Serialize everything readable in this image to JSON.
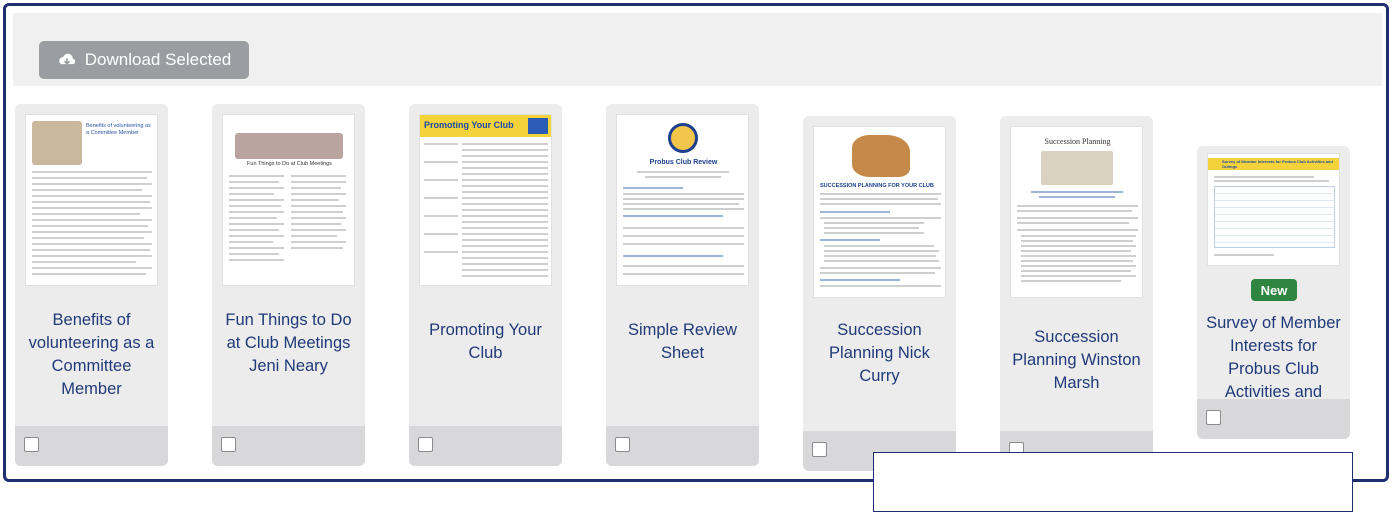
{
  "toolbar": {
    "download_label": "Download Selected"
  },
  "colors": {
    "title": "#1f3a78",
    "frame": "#1f2e6e",
    "button": "#9a9ea3",
    "badge": "#2e8540"
  },
  "cards": [
    {
      "title": "Benefits of volunteering as a Committee Member",
      "thumb_heading": "Benefits of volunteering as a Committee Member"
    },
    {
      "title": "Fun Things to Do at Club Meetings Jeni Neary",
      "thumb_heading": "Fun Things to Do at Club Meetings"
    },
    {
      "title": "Promoting Your Club",
      "thumb_heading": "Promoting Your Club"
    },
    {
      "title": "Simple Review Sheet",
      "thumb_heading": "Probus Club Review"
    },
    {
      "title": "Succession Planning Nick Curry",
      "thumb_heading": "SUCCESSION PLANNING FOR YOUR CLUB"
    },
    {
      "title": "Succession Planning Winston Marsh",
      "thumb_heading": "Succession Planning"
    },
    {
      "title": "Survey of Member Interests for Probus Club Activities and Outings",
      "thumb_heading": "Survey of Member Interests for Probus Club Activities and Outings",
      "badge": "New"
    }
  ]
}
